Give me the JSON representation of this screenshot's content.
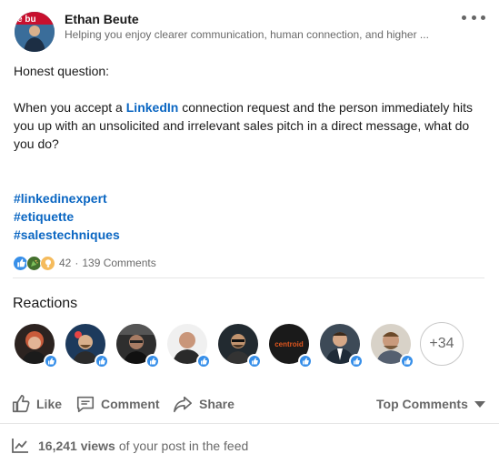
{
  "author": {
    "name": "Ethan Beute",
    "headline": "Helping you enjoy clearer communication, human connection, and higher ...",
    "avatar_icon": "person-avatar"
  },
  "menu": {
    "icon": "more-horizontal-icon"
  },
  "post": {
    "line1": "Honest question:",
    "line2_before": "When you accept a ",
    "line2_link": "LinkedIn",
    "line2_after": " connection request and the person immediately hits you up with an unsolicited and irrelevant sales pitch in a direct message, what do you do?",
    "hashtags": [
      "#linkedinexpert",
      "#etiquette",
      "#salestechniques"
    ]
  },
  "social": {
    "reaction_icons": [
      "like-icon",
      "celebrate-icon",
      "insightful-icon"
    ],
    "reaction_count": "42",
    "separator": "·",
    "comments": "139 Comments"
  },
  "reactions": {
    "title": "Reactions",
    "more": "+34",
    "reactors": [
      {
        "name": "reactor-1",
        "bg": "#3a2a2a",
        "accent": "#c95b3a"
      },
      {
        "name": "reactor-2",
        "bg": "#1d3a5c",
        "accent": "#d9b08c"
      },
      {
        "name": "reactor-3",
        "bg": "#2e2e2e",
        "accent": "#a87c64"
      },
      {
        "name": "reactor-4",
        "bg": "#eeeeee",
        "accent": "#b98b6e"
      },
      {
        "name": "reactor-5",
        "bg": "#222a30",
        "accent": "#c2946f"
      },
      {
        "name": "reactor-6",
        "bg": "#1a1a1a",
        "accent": "#e0561e",
        "text": "centroid"
      },
      {
        "name": "reactor-7",
        "bg": "#3d4a57",
        "accent": "#d6a887"
      },
      {
        "name": "reactor-8",
        "bg": "#d8d2c8",
        "accent": "#c99a7c"
      }
    ]
  },
  "actions": {
    "like": "Like",
    "comment": "Comment",
    "share": "Share",
    "sort": "Top Comments"
  },
  "views": {
    "count": "16,241 views",
    "suffix": "of your post in the feed"
  },
  "colors": {
    "link": "#0a66c2",
    "like_blue": "#378fe9",
    "muted": "#666666"
  }
}
